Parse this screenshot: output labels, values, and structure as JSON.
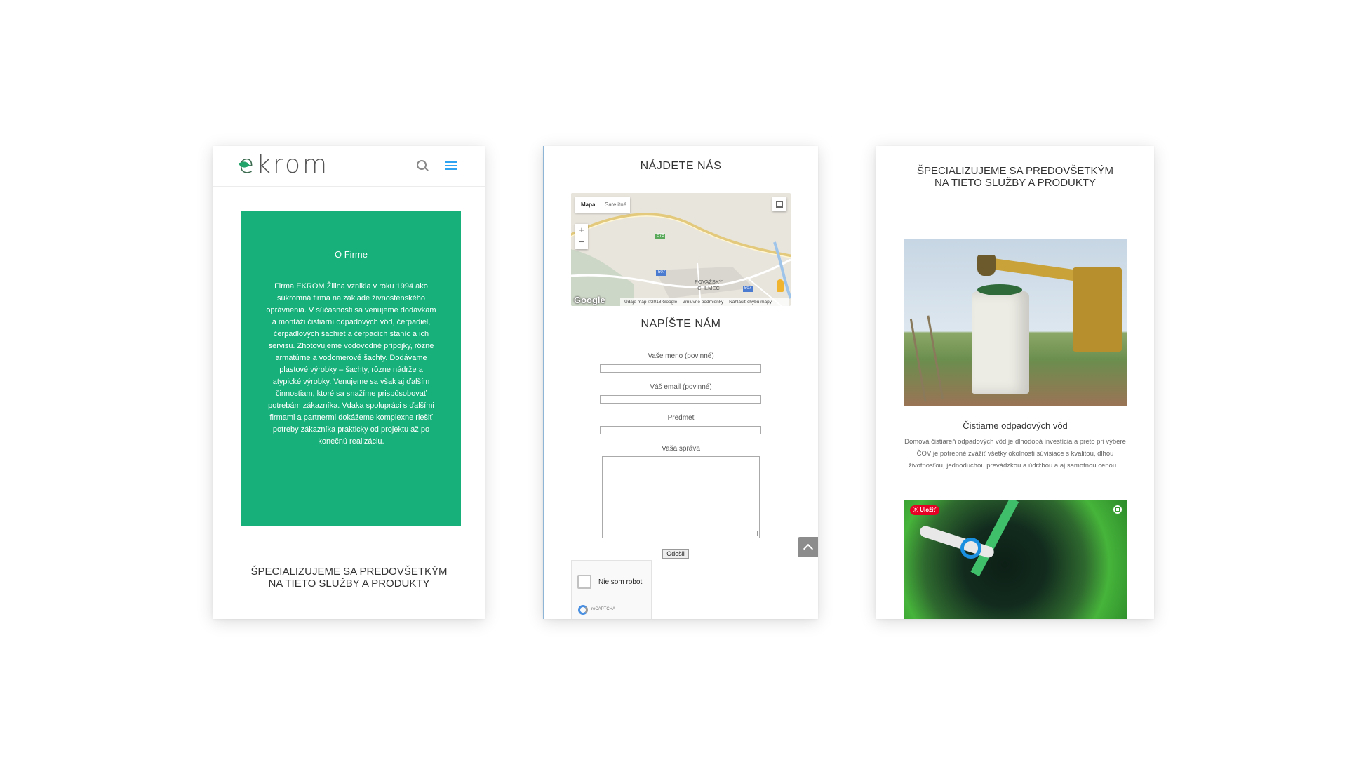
{
  "phone1": {
    "logo": {
      "e": "e",
      "rest": "krom"
    },
    "about": {
      "title": "O Firme",
      "text": "Firma EKROM Žilina vznikla v roku 1994 ako súkromná firma na základe živnostenského oprávnenia. V súčasnosti sa venujeme dodávkam a montáži čistiarní odpadových vôd, čerpadiel, čerpadlových šachiet a čerpacích staníc a ich servisu. Zhotovujeme vodovodné prípojky, rôzne armatúrne a vodomerové šachty. Dodávame plastové výrobky – šachty, rôzne nádrže a atypické výrobky. Venujeme sa však aj ďalším činnostiam, ktoré sa snažíme prispôsobovať potrebám zákazníka. Vdaka spolupráci s ďalšími firmami a partnermi dokážeme komplexne riešiť potreby zákazníka prakticky od projektu až po konečnú realizáciu."
    },
    "specialize_line1": "ŠPECIALIZUJEME  SA PREDOVŠETKÝM",
    "specialize_line2": "NA TIETO SLUŽBY A PRODUKTY"
  },
  "phone2": {
    "find_us": "NÁJDETE NÁS",
    "map": {
      "type_map": "Mapa",
      "type_satellite": "Satelitné",
      "zoom_in": "+",
      "zoom_out": "−",
      "place_line1": "POVAŽSKÝ",
      "place_line2": "CHLMEC",
      "road_e75": "E75",
      "road_507a": "507",
      "road_507b": "507",
      "google": "Google",
      "footer_data": "Údaje máp ©2018 Google",
      "footer_terms": "Zmluvné podmienky",
      "footer_report": "Nahlásiť chybu mapy"
    },
    "write_us": "NAPÍŠTE NÁM",
    "form": {
      "name_label": "Vaše meno (povinné)",
      "email_label": "Váš email (povinné)",
      "subject_label": "Predmet",
      "message_label": "Vaša správa",
      "submit": "Odošli"
    },
    "captcha": {
      "label": "Nie som robot",
      "brand": "reCAPTCHA"
    }
  },
  "phone3": {
    "specialize_line1": "ŠPECIALIZUJEME  SA PREDOVŠETKÝM",
    "specialize_line2": "NA TIETO SLUŽBY A PRODUKTY",
    "service_title": "Čistiarne odpadových vôd",
    "service_text": "Domová čistiareň odpadových vôd je dlhodobá investícia a preto pri výbere ČOV je potrebné zvážiť všetky okolnosti súvisiace s kvalitou, dlhou životnosťou, jednoduchou prevádzkou a údržbou a aj samotnou cenou...",
    "save_label": "Uložiť"
  },
  "colors": {
    "brand_green": "#17b07a",
    "accent_blue": "#2ea3f2"
  }
}
